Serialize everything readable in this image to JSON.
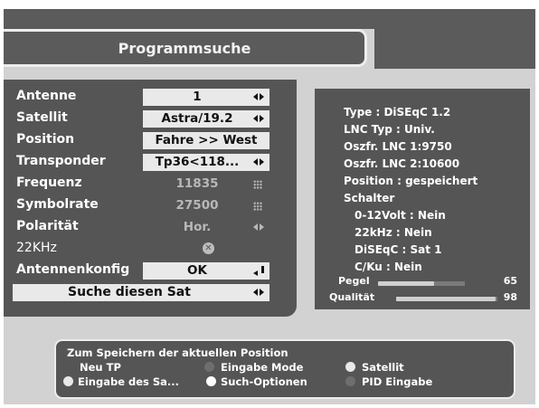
{
  "title": "Programmsuche",
  "menu": {
    "rows": [
      {
        "label": "Antenne",
        "value": "1",
        "control": "arrows"
      },
      {
        "label": "Satellit",
        "value": "Astra/19.2",
        "control": "arrows"
      },
      {
        "label": "Position",
        "value": "Fahre >> West",
        "control": "none"
      },
      {
        "label": "Transponder",
        "value": "Tp36<118...",
        "control": "arrows"
      },
      {
        "label": "Frequenz",
        "value": "11835",
        "control": "keypad"
      },
      {
        "label": "Symbolrate",
        "value": "27500",
        "control": "keypad"
      },
      {
        "label": "Polarität",
        "value": "Hor.",
        "control": "arrows"
      },
      {
        "label": "22KHz",
        "value": "",
        "control": "x-circle"
      },
      {
        "label": "Antennenkonfig",
        "value": "OK",
        "control": "enter"
      }
    ],
    "search_button": "Suche diesen Sat"
  },
  "info": {
    "lines": [
      "Type : DiSEqC 1.2",
      "LNC Typ : Univ.",
      "Oszfr. LNC 1:9750",
      "Oszfr. LNC 2:10600",
      "Position : gespeichert",
      "Schalter",
      "0-12Volt : Nein",
      "22kHz : Nein",
      "DiSEqC : Sat 1",
      "C/Ku : Nein"
    ],
    "pegel": {
      "label": "Pegel",
      "value": "65",
      "level": 0.65
    },
    "qualitaet": {
      "label": "Qualität",
      "value": "98",
      "level": 0.98
    }
  },
  "help": {
    "line1": "Zum Speichern der aktuellen Position",
    "line2": "Neu TP",
    "items": [
      {
        "label": "Eingabe Mode",
        "color": "#6e6e6e"
      },
      {
        "label": "Satellit",
        "color": "#e8e8e8"
      },
      {
        "label": "Eingabe des Sa...",
        "color": "#e8e8e8"
      },
      {
        "label": "Such-Optionen",
        "color": "#ffffff"
      },
      {
        "label": "PID Eingabe",
        "color": "#6e6e6e"
      }
    ]
  },
  "colors": {
    "panel": "#555555",
    "background": "#d2d2d2",
    "highlight": "#e9e9e9"
  }
}
